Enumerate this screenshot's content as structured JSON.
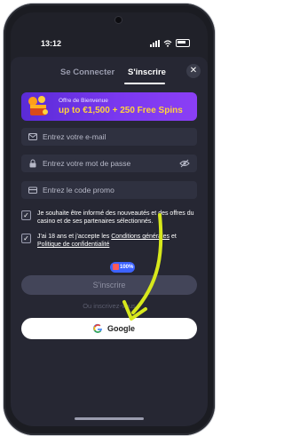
{
  "status": {
    "time": "13:12"
  },
  "tabs": [
    {
      "label": "Se Connecter",
      "active": false
    },
    {
      "label": "S'inscrire",
      "active": true
    }
  ],
  "banner": {
    "subtitle": "Offre de Bienvenue",
    "headline": "up to €1,500 + 250 Free Spins"
  },
  "form": {
    "email_placeholder": "Entrez votre e-mail",
    "password_placeholder": "Entrez votre mot de passe",
    "promo_placeholder": "Entrez le code promo"
  },
  "checkboxes": [
    {
      "text": "Je souhaite être informé des nouveautés et des offres du casino et de ses partenaires sélectionnés.",
      "checked": true
    },
    {
      "prefix": "J'ai 18 ans et j'accepte les ",
      "link1": "Conditions générales",
      "middle": " et ",
      "link2": "Politique de confidentialité",
      "checked": true
    }
  ],
  "badge": {
    "label": "100%"
  },
  "submit_label": "S'inscrire",
  "or_text": "Ou inscrivez-vous",
  "google_label": "Google",
  "colors": {
    "background": "#202129",
    "modal": "#262733",
    "field": "#2f3140",
    "banner_start": "#5a2bd6",
    "banner_text": "#ffd33d",
    "arrow": "#d7e81c"
  }
}
